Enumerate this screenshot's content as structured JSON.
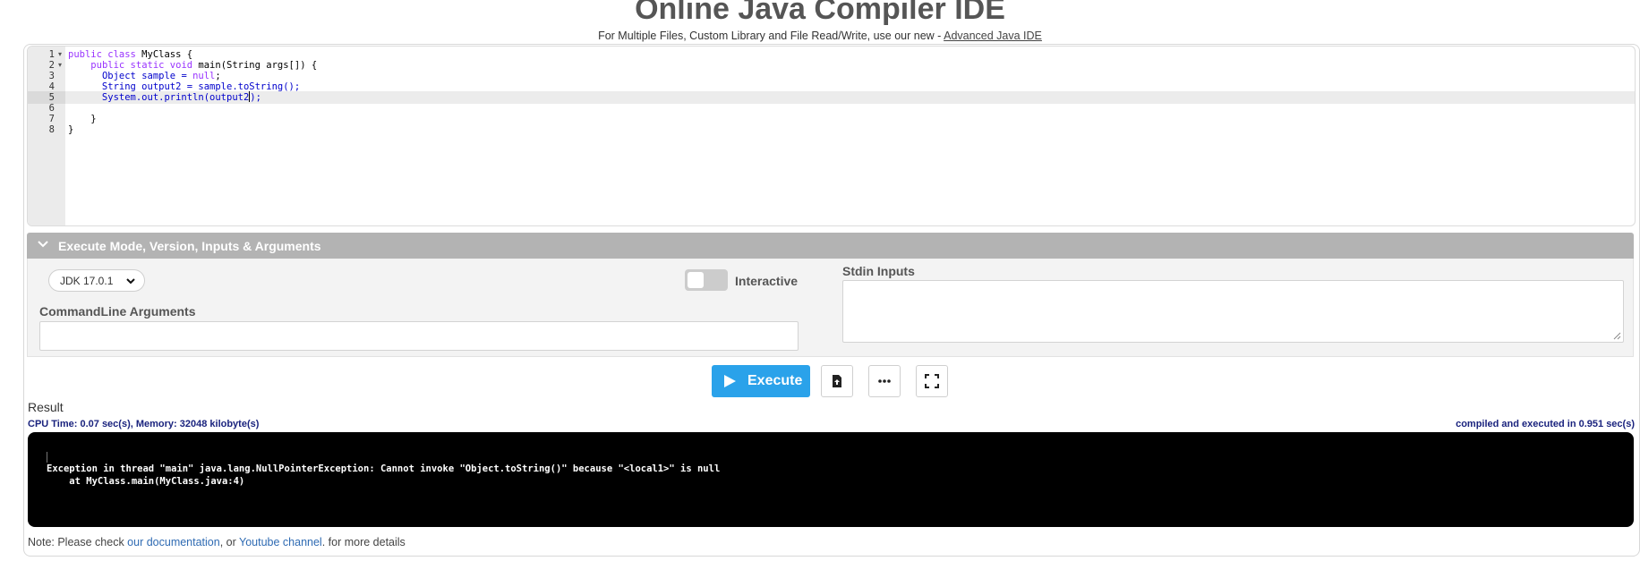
{
  "header": {
    "title": "Online Java Compiler IDE",
    "subtitle_prefix": "For Multiple Files, Custom Library and File Read/Write, use our new - ",
    "subtitle_link": "Advanced Java IDE"
  },
  "editor": {
    "line_numbers": [
      "1",
      "2",
      "3",
      "4",
      "5",
      "6",
      "7",
      "8"
    ],
    "active_line": "5",
    "code": {
      "l1_kw": "public class",
      "l1_rest": " MyClass {",
      "l2_indent": "    ",
      "l2_kw": "public static void",
      "l2_rest": " main(String args[]) {",
      "l3_indent": "      ",
      "l3_a": "Object sample = ",
      "l3_kw": "null",
      "l3_b": ";",
      "l4": "      String output2 = sample.toString();",
      "l5_a": "      System.out.println(output2",
      "l5_b": ");",
      "l6": "",
      "l7": "    }",
      "l8": "}"
    }
  },
  "execute_panel": {
    "header": "Execute Mode, Version, Inputs & Arguments",
    "jdk_version": "JDK 17.0.1",
    "interactive_label": "Interactive",
    "interactive_on": false,
    "commandline_label": "CommandLine Arguments",
    "stdin_label": "Stdin Inputs"
  },
  "actions": {
    "execute_label": "Execute"
  },
  "result": {
    "label": "Result",
    "cpu_time": "CPU Time: 0.07 sec(s), Memory: 32048 kilobyte(s)",
    "compiled": "compiled and executed in 0.951 sec(s)",
    "output": "Exception in thread \"main\" java.lang.NullPointerException: Cannot invoke \"Object.toString()\" because \"<local1>\" is null\n    at MyClass.main(MyClass.java:4)"
  },
  "note": {
    "prefix": "Note: Please check ",
    "link1": "our documentation",
    "middle": ", or ",
    "link2": "Youtube channel",
    "suffix": ". for more details"
  },
  "colors": {
    "accent": "#2aa2ea",
    "panel_header": "#b3b3b3",
    "keyword": "#9933ff",
    "result_text": "#1a237e"
  }
}
